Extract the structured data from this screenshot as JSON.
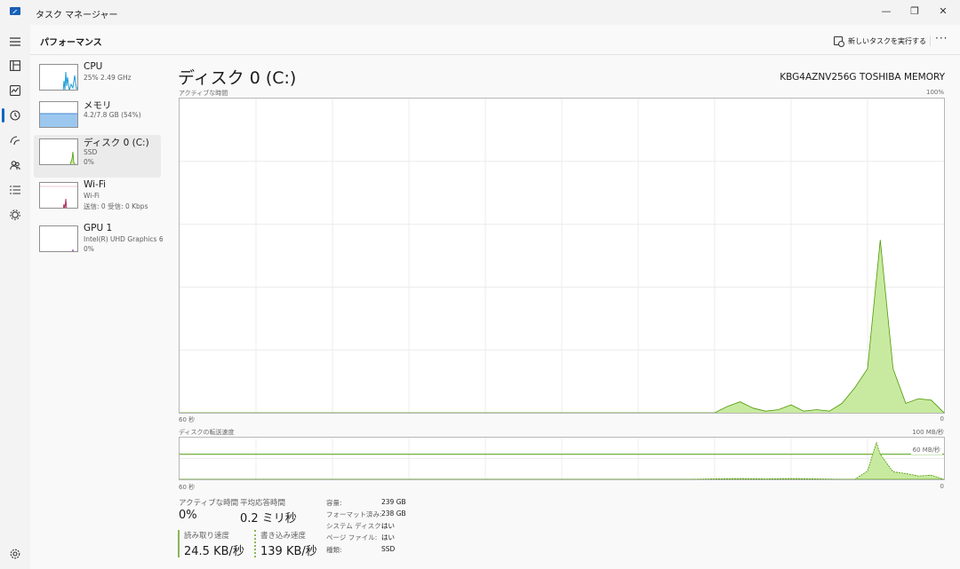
{
  "window": {
    "title": "タスク マネージャー",
    "controls": {
      "minimize": "—",
      "maximize": "❐",
      "close": "✕"
    }
  },
  "rail": {
    "icons": [
      "menu-icon",
      "processes-icon",
      "performance-icon",
      "app-history-icon",
      "startup-icon",
      "users-icon",
      "details-icon",
      "services-icon",
      "settings-icon"
    ]
  },
  "header": {
    "title": "パフォーマンス",
    "run_new_task": "新しいタスクを実行する",
    "more": "···"
  },
  "resources": [
    {
      "name": "CPU",
      "sub": "25%  2.49 GHz",
      "sub2": ""
    },
    {
      "name": "メモリ",
      "sub": "4.2/7.8 GB (54%)",
      "sub2": ""
    },
    {
      "name": "ディスク 0 (C:)",
      "sub": "SSD",
      "sub2": "0%"
    },
    {
      "name": "Wi-Fi",
      "sub": "Wi-Fi",
      "sub2": "送信: 0  受信: 0 Kbps"
    },
    {
      "name": "GPU 1",
      "sub": "Intel(R) UHD Graphics 6",
      "sub2": "0%"
    }
  ],
  "detail": {
    "title": "ディスク 0 (C:)",
    "model": "KBG4AZNV256G TOSHIBA MEMORY",
    "active_time_chart_label": "アクティブな時間",
    "active_time_max": "100%",
    "active_time_time_left": "60 秒",
    "active_time_min": "0",
    "transfer_chart_label": "ディスクの転送速度",
    "transfer_max": "100 MB/秒",
    "transfer_mid": "60 MB/秒",
    "transfer_time_left": "60 秒",
    "transfer_min": "0"
  },
  "stats": {
    "active_time_label": "アクティブな時間",
    "active_time_value": "0%",
    "response_label": "平均応答時間",
    "response_value": "0.2 ミリ秒",
    "read_label": "読み取り速度",
    "read_value": "24.5 KB/秒",
    "write_label": "書き込み速度",
    "write_value": "139 KB/秒"
  },
  "properties": [
    {
      "key": "容量:",
      "value": "239 GB"
    },
    {
      "key": "フォーマット済み:",
      "value": "238 GB"
    },
    {
      "key": "システム ディスク:",
      "value": "はい"
    },
    {
      "key": "ページ ファイル:",
      "value": "はい"
    },
    {
      "key": "種類:",
      "value": "SSD"
    }
  ],
  "colors": {
    "disk_line": "#4e9a06",
    "disk_fill": "#c8eaa0",
    "cpu_line": "#1f9cd6",
    "memory_fill": "#9cc8f0",
    "wifi_line": "#b03060",
    "gpu_line": "#9b59d0"
  },
  "chart_data": [
    {
      "type": "area",
      "ylabel": "アクティブな時間",
      "xlabel": "60 秒",
      "ylim": [
        0,
        100
      ],
      "x": [
        60,
        56,
        54,
        52,
        50,
        48,
        46,
        44,
        42,
        40,
        38,
        36,
        34,
        32,
        30,
        28,
        26,
        24,
        22,
        20,
        19,
        18,
        17,
        16,
        15,
        14,
        13,
        12,
        11,
        10,
        9,
        8,
        7,
        6,
        5,
        4,
        3,
        2,
        1,
        0
      ],
      "series": [
        {
          "values": [
            0,
            0,
            0,
            0,
            0,
            0,
            0,
            0,
            0,
            0,
            0,
            0,
            0,
            0,
            0,
            0,
            0,
            0,
            0,
            0,
            0,
            0,
            2,
            3.5,
            1.5,
            0.5,
            1,
            2.5,
            0.5,
            1,
            0.5,
            3,
            8,
            14,
            55,
            14,
            3,
            4.5,
            4,
            0
          ]
        }
      ]
    },
    {
      "type": "area",
      "ylabel": "ディスクの転送速度",
      "xlabel": "60 秒",
      "ylim": [
        0,
        100
      ],
      "x": [
        60,
        20,
        18,
        16,
        14,
        12,
        10,
        8,
        7,
        6,
        5.3,
        5,
        4,
        3,
        2,
        1,
        0
      ],
      "series": [
        {
          "name": "読み取り速度",
          "values": [
            0,
            0,
            0,
            0,
            0,
            0,
            0,
            0,
            0,
            0,
            0,
            0,
            0,
            0,
            0,
            0,
            0
          ]
        },
        {
          "name": "書き込み速度",
          "values": [
            0,
            0,
            1,
            2,
            1,
            2,
            1,
            0,
            0,
            20,
            88,
            60,
            18,
            14,
            8,
            10,
            0
          ]
        }
      ]
    }
  ]
}
